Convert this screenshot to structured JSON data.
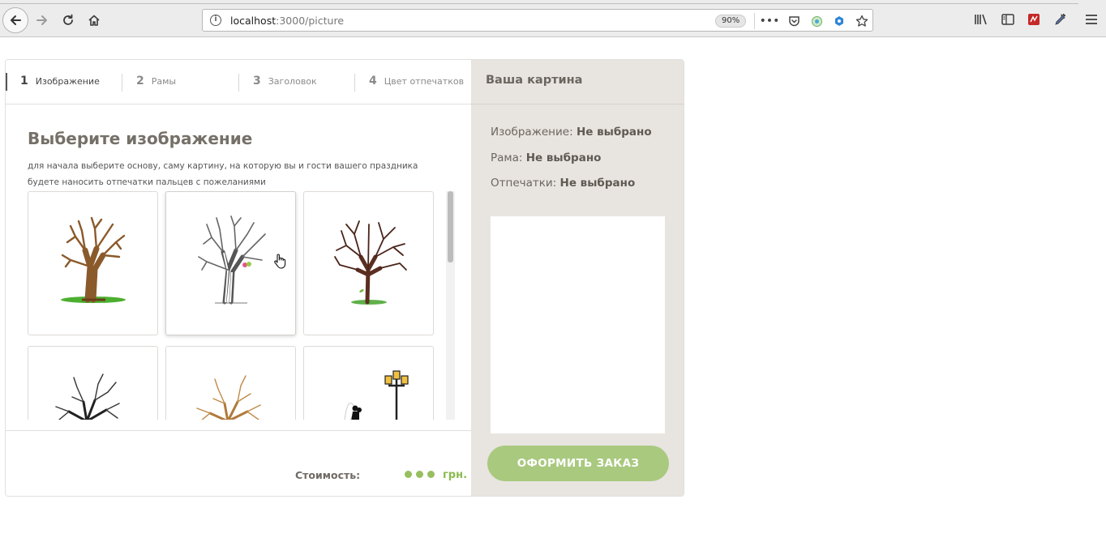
{
  "browser": {
    "url_host": "localhost",
    "url_path": ":3000/picture",
    "zoom": "90%"
  },
  "steps": [
    {
      "num": "1",
      "label": "Изображение",
      "active": true
    },
    {
      "num": "2",
      "label": "Рамы",
      "active": false
    },
    {
      "num": "3",
      "label": "Заголовок",
      "active": false
    },
    {
      "num": "4",
      "label": "Цвет отпечатков",
      "active": false
    }
  ],
  "main": {
    "title": "Выберите изображение",
    "subtitle": "для начала выберите основу, саму картину, на которую вы и гости вашего праздника будете наносить отпечатки пальцев с пожеланиями"
  },
  "images": [
    {
      "icon": "brown-tree-on-grass-icon"
    },
    {
      "icon": "white-birch-with-birds-icon"
    },
    {
      "icon": "dark-tree-with-leaf-icon"
    },
    {
      "icon": "black-bare-tree-icon"
    },
    {
      "icon": "orange-bare-tree-icon"
    },
    {
      "icon": "couple-with-lamppost-icon"
    }
  ],
  "footer": {
    "price_label": "Стоимость:",
    "currency": "грн."
  },
  "summary": {
    "title": "Ваша картина",
    "image_label": "Изображение:",
    "image_value": "Не выбрано",
    "frame_label": "Рама:",
    "frame_value": "Не выбрано",
    "prints_label": "Отпечатки:",
    "prints_value": "Не выбрано",
    "order_button": "ОФОРМИТЬ ЗАКАЗ"
  },
  "colors": {
    "accent_green": "#a9c97f",
    "price_green": "#8bbb4e",
    "panel_bg": "#e8e4df"
  }
}
